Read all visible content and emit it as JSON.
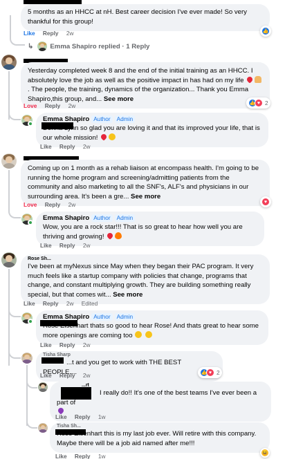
{
  "comments": [
    {
      "id": "c1",
      "text": "5 months as an HHCC at nH. Best career decision I've ever made! So very thankful for this group!",
      "like": "Like",
      "reply": "Reply",
      "time": "2w",
      "replies_link": "Emma Shapiro replied · 1 Reply"
    },
    {
      "id": "c2",
      "text": "Yesterday completed week 8 and the end of the initial training as an HHCC. I absolutely love the job as well as the positive impact in has had on my life",
      "text2": "The people, the training, dynamics of the organization... Thank you Emma Shapiro,this group, and...",
      "see_more": "See more",
      "like": "Love",
      "reply": "Reply",
      "time": "2w",
      "count": "2"
    },
    {
      "id": "r2",
      "name": "Emma Shapiro",
      "tag1": "Author",
      "tag2": "Admin",
      "text": "Donna Lynn so glad you are loving it and that its improved your life, that is our whole mission!",
      "like": "Like",
      "reply": "Reply",
      "time": "2w"
    },
    {
      "id": "c3",
      "text": "Coming up on 1 month as a rehab liaison at encompass health. I'm going to be running the home program and screening/admitting patients from the community and also marketing to all the SNF's, ALF's and physicians in our surrounding area. It's been a gre...",
      "see_more": "See more",
      "like": "Love",
      "reply": "Reply",
      "time": "2w"
    },
    {
      "id": "r3",
      "name": "Emma Shapiro",
      "tag1": "Author",
      "tag2": "Admin",
      "text": "Wow, you are a rock star!!! That is so great to hear how well you are thriving and growing!",
      "like": "Like",
      "reply": "Reply",
      "time": "2w"
    },
    {
      "id": "c4",
      "name": "Rose Sh...",
      "text": "I've been at myNexus since May when they began their PAC program. It very much feels like a startup company with policies that change, programs that change, and constant multiplying growth. They are building something really special, but that comes wit...",
      "see_more": "See more",
      "like": "Like",
      "reply": "Reply",
      "time": "2w",
      "edited": "Edited"
    },
    {
      "id": "r4",
      "name": "Emma Shapiro",
      "tag1": "Author",
      "tag2": "Admin",
      "text": "Rose Eisenhart thats so good to hear Rose! And thats great to hear some more openings are coming too",
      "like": "Like",
      "reply": "Reply",
      "time": "2w"
    },
    {
      "id": "r5",
      "name": "Tisha Sharp",
      "text": "...t and you get to work with THE BEST PEOPLE....",
      "like": "Like",
      "reply": "Reply",
      "time": "2w",
      "count": "2"
    },
    {
      "id": "r6",
      "name": "...rt",
      "text": "I really do!! It's one of the best teams I've ever been a part of",
      "like": "Like",
      "reply": "Reply",
      "time": "1w"
    },
    {
      "id": "r7",
      "name": "Tisha Sh...",
      "text": "Rose Eisenhart this is my last job ever. Will retire with this company. Maybe there will be a job aid named after me!!!",
      "like": "Like",
      "reply": "Reply",
      "time": "1w"
    }
  ],
  "icons": [
    "like-reaction-icon",
    "love-reaction-icon",
    "haha-reaction-icon",
    "reply-arrow-icon"
  ],
  "colors": {
    "link": "#1b74e4",
    "love": "#f02849",
    "bubble": "#f0f2f5",
    "meta": "#65676b"
  }
}
